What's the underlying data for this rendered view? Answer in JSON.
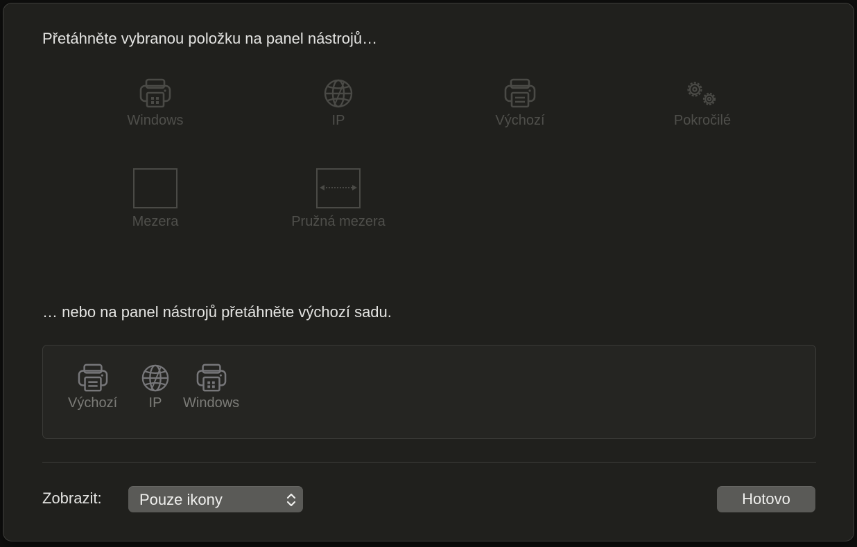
{
  "headings": {
    "drag_item": "Přetáhněte vybranou položku na panel nástrojů…",
    "drag_default": "… nebo na panel nástrojů přetáhněte výchozí sadu."
  },
  "palette": {
    "items": [
      {
        "label": "Windows",
        "icon": "printer-windows-icon"
      },
      {
        "label": "IP",
        "icon": "globe-icon"
      },
      {
        "label": "Výchozí",
        "icon": "printer-icon"
      },
      {
        "label": "Pokročilé",
        "icon": "gears-icon"
      },
      {
        "label": "Mezera",
        "icon": "space-icon"
      },
      {
        "label": "Pružná mezera",
        "icon": "flexible-space-icon"
      }
    ]
  },
  "default_set": {
    "items": [
      {
        "label": "Výchozí",
        "icon": "printer-icon"
      },
      {
        "label": "IP",
        "icon": "globe-icon"
      },
      {
        "label": "Windows",
        "icon": "printer-windows-icon"
      }
    ]
  },
  "footer": {
    "show_label": "Zobrazit:",
    "show_value": "Pouze ikony",
    "done_label": "Hotovo"
  },
  "colors": {
    "sheet_background": "#20201d",
    "disabled_text": "#4f4f4b",
    "button_fill": "#5a5a57"
  }
}
